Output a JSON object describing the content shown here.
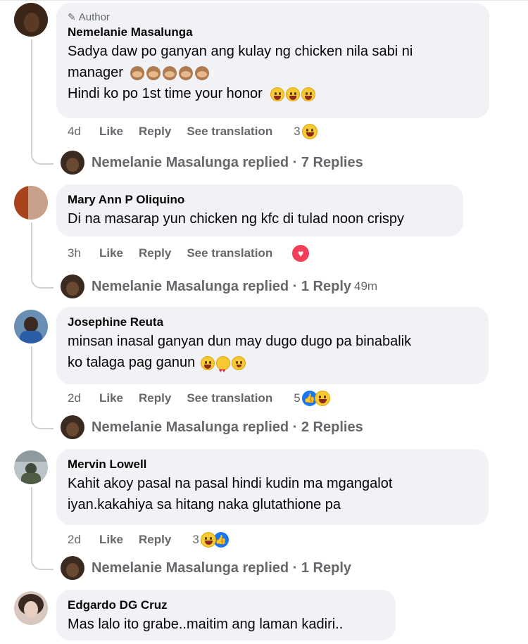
{
  "comments": [
    {
      "author_badge": "Author",
      "name": "Nemelanie Masalunga",
      "lines": [
        "Sadya daw po ganyan ang kulay ng chicken nila sabi ni",
        "manager",
        "Hindi ko po 1st time your honor"
      ],
      "time": "4d",
      "like": "Like",
      "reply": "Reply",
      "translate": "See translation",
      "reaction_count": "3",
      "replies_text": "Nemelanie Masalunga replied · 7 Replies",
      "avatar_color": "#3b2418"
    },
    {
      "name": "Mary Ann P Oliquino",
      "lines": [
        "Di na masarap yun chicken ng kfc di tulad noon crispy"
      ],
      "time": "3h",
      "like": "Like",
      "reply": "Reply",
      "translate": "See translation",
      "reaction_count": "",
      "replies_text": "Nemelanie Masalunga replied · 1 Reply",
      "replies_ago": "49m",
      "avatar_color": "#c9a08a"
    },
    {
      "name": "Josephine Reuta",
      "lines": [
        "minsan inasal ganyan dun may dugo dugo pa binabalik",
        "ko talaga pag ganun"
      ],
      "time": "2d",
      "like": "Like",
      "reply": "Reply",
      "translate": "See translation",
      "reaction_count": "5",
      "replies_text": "Nemelanie Masalunga replied · 2 Replies",
      "avatar_color": "#6a8fb5"
    },
    {
      "name": "Mervin Lowell",
      "lines": [
        "Kahit akoy pasal na pasal hindi kudin ma mgangalot",
        "iyan.kakahiya sa hitang naka glutathione pa"
      ],
      "time": "2d",
      "like": "Like",
      "reply": "Reply",
      "reaction_count": "3",
      "replies_text": "Nemelanie Masalunga replied · 1 Reply",
      "avatar_color": "#7a8a6a"
    },
    {
      "name": "Edgardo DG Cruz",
      "lines": [
        "Mas lalo ito grabe..maitim ang laman kadiri.."
      ],
      "avatar_color": "#d8c8c0"
    }
  ],
  "colors": {
    "bubble": "#f0f2f5",
    "meta": "#65676b",
    "like_blue": "#1877f2",
    "love_red": "#f33e58"
  }
}
